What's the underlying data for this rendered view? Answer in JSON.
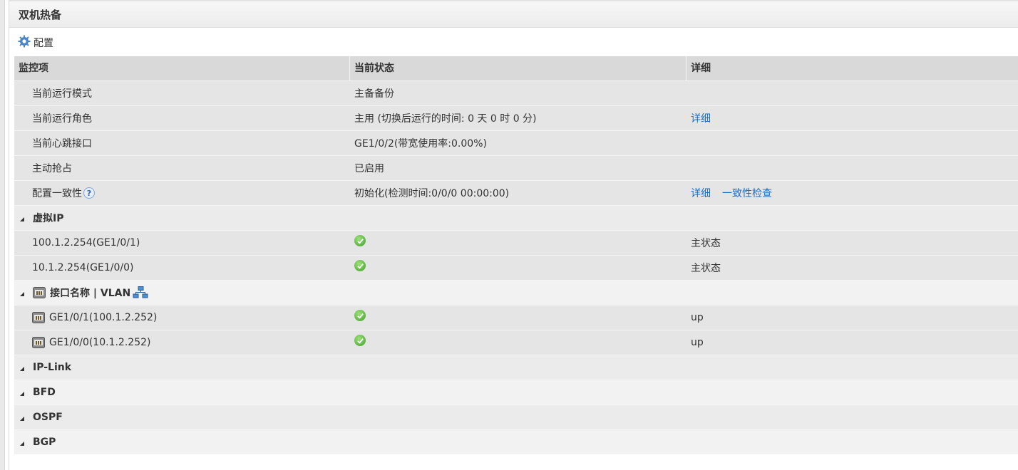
{
  "page_title": "双机热备",
  "toolbar": {
    "config_label": "配置",
    "config_icon": "gear-icon"
  },
  "table": {
    "headers": [
      "监控项",
      "当前状态",
      "详细"
    ],
    "rows": [
      {
        "item": "当前运行模式",
        "status": "主备备份",
        "detail": ""
      },
      {
        "item": "当前运行角色",
        "status": "主用 (切换后运行的时间: 0 天 0 时 0 分)",
        "links": [
          "详细"
        ]
      },
      {
        "item": "当前心跳接口",
        "status": "GE1/0/2(带宽使用率:0.00%)",
        "detail": ""
      },
      {
        "item": "主动抢占",
        "status": "已启用",
        "detail": ""
      },
      {
        "item": "配置一致性",
        "help": "?",
        "status": "初始化(检测时间:0/0/0 00:00:00)",
        "links": [
          "详细",
          "一致性检查"
        ]
      }
    ],
    "groups": {
      "virtual_ip": {
        "label": "虚拟IP",
        "rows": [
          {
            "item": "100.1.2.254(GE1/0/1)",
            "detail": "主状态"
          },
          {
            "item": "10.1.2.254(GE1/0/0)",
            "detail": "主状态"
          }
        ]
      },
      "interface": {
        "label": "接口名称 | VLAN",
        "rows": [
          {
            "item": "GE1/0/1(100.1.2.252)",
            "detail": "up"
          },
          {
            "item": "GE1/0/0(10.1.2.252)",
            "detail": "up"
          }
        ]
      },
      "collapsed": [
        "IP-Link",
        "BFD",
        "OSPF",
        "BGP"
      ]
    }
  },
  "colors": {
    "link": "#1b6ec2",
    "ok": "#3f9e2a",
    "header_bg": "#d9d9d9"
  }
}
